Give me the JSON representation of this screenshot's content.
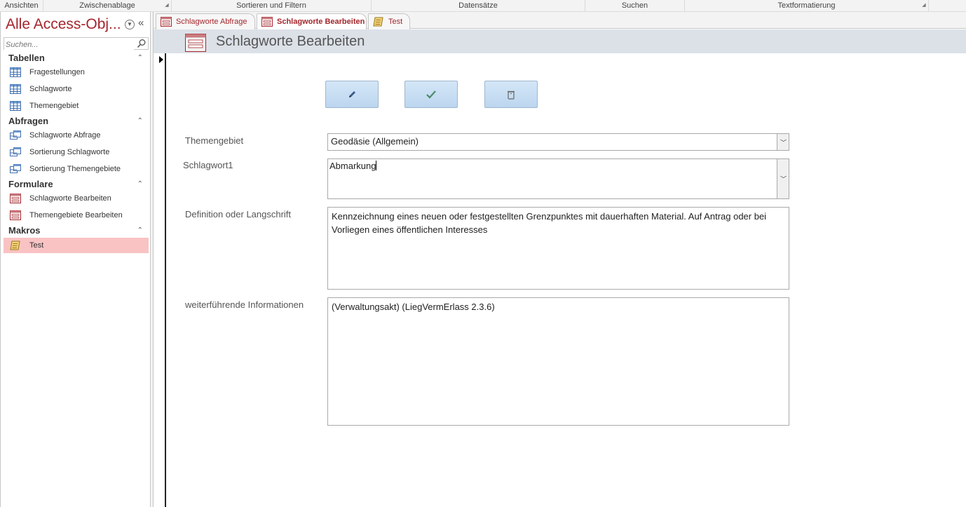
{
  "ribbon": {
    "groups": [
      "Ansichten",
      "Zwischenablage",
      "Sortieren und Filtern",
      "Datensätze",
      "Suchen",
      "Textformatierung"
    ]
  },
  "nav": {
    "title": "Alle Access-Obj...",
    "search_placeholder": "Suchen...",
    "sections": {
      "tabellen": {
        "label": "Tabellen",
        "items": [
          "Fragestellungen",
          "Schlagworte",
          "Themengebiet"
        ]
      },
      "abfragen": {
        "label": "Abfragen",
        "items": [
          "Schlagworte Abfrage",
          "Sortierung Schlagworte",
          "Sortierung Themengebiete"
        ]
      },
      "formulare": {
        "label": "Formulare",
        "items": [
          "Schlagworte Bearbeiten",
          "Themengebiete Bearbeiten"
        ]
      },
      "makros": {
        "label": "Makros",
        "items": [
          "Test"
        ]
      }
    }
  },
  "tabs": [
    "Schlagworte Abfrage",
    "Schlagworte Bearbeiten",
    "Test"
  ],
  "form": {
    "title": "Schlagworte Bearbeiten",
    "fields": {
      "themengebiet": {
        "label": "Themengebiet",
        "value": "Geodäsie (Allgemein)"
      },
      "schlagwort": {
        "label": "Schlagwort1",
        "value": "Abmarkung"
      },
      "definition": {
        "label": "Definition oder Langschrift",
        "value": "Kennzeichnung eines neuen oder festgestellten Grenzpunktes mit dauerhaften Material. Auf Antrag oder bei Vorliegen eines öffentlichen Interesses"
      },
      "info": {
        "label": "weiterführende Informationen",
        "value": "(Verwaltungsakt) (LiegVermErlass 2.3.6)"
      }
    }
  },
  "colors": {
    "accent": "#a4262c",
    "header_bg": "#dce1e8",
    "selected_bg": "#f9c3c3",
    "button_bg": "#c8def3"
  },
  "icons": {
    "edit": "pencil-icon",
    "save": "checkmark-icon",
    "delete": "trash-icon"
  }
}
